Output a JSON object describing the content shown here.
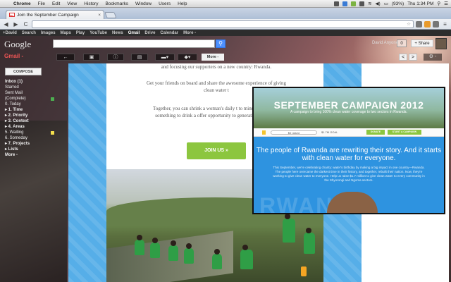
{
  "menubar": {
    "app": "Chrome",
    "items": [
      "File",
      "Edit",
      "View",
      "History",
      "Bookmarks",
      "Window",
      "Users",
      "Help"
    ],
    "battery": "(93%)",
    "clock": "Thu 1:34 PM"
  },
  "browser": {
    "tab_title": "Join the September Campaign",
    "tab_close": "×",
    "back": "◀",
    "forward": "▶",
    "reload": "C"
  },
  "gbar": {
    "items": [
      "+David",
      "Search",
      "Images",
      "Maps",
      "Play",
      "YouTube",
      "News",
      "Gmail",
      "Drive",
      "Calendar",
      "More -"
    ],
    "active": "Gmail"
  },
  "header": {
    "logo": "Google",
    "user": "David Anyone",
    "notif": "0",
    "share": "+ Share",
    "gmail_label": "Gmail -",
    "more_label": "More -",
    "pager_prev": "<",
    "pager_next": ">",
    "gear": "⚙ -"
  },
  "sidebar": {
    "compose": "COMPOSE",
    "labels": [
      {
        "label": "Inbox (1)",
        "bold": true,
        "color": ""
      },
      {
        "label": "Starred",
        "bold": false,
        "color": ""
      },
      {
        "label": "Sent Mail",
        "bold": false,
        "color": ""
      },
      {
        "label": "(Complete)",
        "bold": false,
        "color": "#4caf50"
      },
      {
        "label": "0. Today",
        "bold": false,
        "color": ""
      },
      {
        "label": "▸ 1. Time",
        "bold": true,
        "color": ""
      },
      {
        "label": "▸ 2. Priority",
        "bold": true,
        "color": ""
      },
      {
        "label": "▸ 3. Context",
        "bold": true,
        "color": ""
      },
      {
        "label": "▸ 4. Areas",
        "bold": true,
        "color": ""
      },
      {
        "label": "5. Waiting",
        "bold": false,
        "color": "#f4e04d"
      },
      {
        "label": "6. Someday",
        "bold": false,
        "color": ""
      },
      {
        "label": "▸ 7. Projects",
        "bold": true,
        "color": ""
      },
      {
        "label": "▸ Lists",
        "bold": true,
        "color": ""
      },
      {
        "label": "More -",
        "bold": true,
        "color": ""
      }
    ]
  },
  "email": {
    "p1": "and focusing our supporters on a new country: Rwanda.",
    "p2": "Get your friends on board and share the awesome experience of giving clean water t",
    "p3": "Together, you can shrink a woman's daily t to minutes, give kids something to drink a offer opportunity to generations of peopl",
    "join_button": "JOIN US »"
  },
  "popup": {
    "title": "SEPTEMBER CAMPAIGN 2012",
    "subtitle": "A campaign to bring 100% clean water coverage to two sectors in Rwanda.",
    "raised": "$0 raised",
    "goal": "$1.7M GOAL",
    "donate": "DONATE",
    "start": "START A CAMPAIGN",
    "headline": "The people of Rwanda are rewriting their story. And it starts with clean water for everyone.",
    "paragraph": "This September, we're celebrating charity: water's birthday by making a big impact in one country—Rwanda. The people here overcame the darkest time in their history, and together, rebuilt their nation. Now, they're working to give clean water to everyone. Help us raise $1.7 million to give clean water to every community in the Shyorongi and Ngoma sectors.",
    "watermark": "RWANDA"
  }
}
